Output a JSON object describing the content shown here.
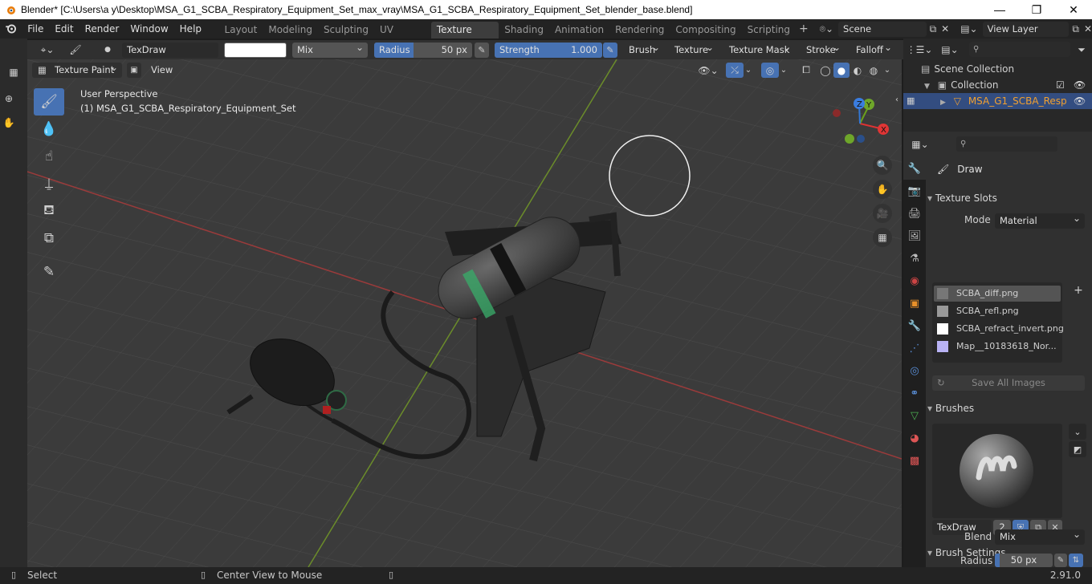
{
  "window": {
    "title": "Blender* [C:\\Users\\a y\\Desktop\\MSA_G1_SCBA_Respiratory_Equipment_Set_max_vray\\MSA_G1_SCBA_Respiratory_Equipment_Set_blender_base.blend]",
    "minimize": "—",
    "maximize": "❐",
    "close": "✕"
  },
  "menu": [
    "File",
    "Edit",
    "Render",
    "Window",
    "Help"
  ],
  "workspaces": [
    "Layout",
    "Modeling",
    "Sculpting",
    "UV Editing",
    "Texture Paint",
    "Shading",
    "Animation",
    "Rendering",
    "Compositing",
    "Scripting"
  ],
  "active_workspace": "Texture Paint",
  "scene": "Scene",
  "view_layer": "View Layer",
  "toolbar": {
    "brush_name": "TexDraw",
    "blend": "Mix",
    "radius_label": "Radius",
    "radius_value": "50 px",
    "strength_label": "Strength",
    "strength_value": "1.000",
    "strength_fraction": 1.0,
    "brush_menu": "Brush",
    "texture_menu": "Texture",
    "texture_mask_menu": "Texture Mask",
    "stroke_menu": "Stroke",
    "falloff_menu": "Falloff"
  },
  "viewport_header": {
    "mode": "Texture Paint",
    "view_menu": "View"
  },
  "viewport": {
    "perspective_label": "User Perspective",
    "object_label": "(1) MSA_G1_SCBA_Respiratory_Equipment_Set",
    "gizmo": {
      "x": "X",
      "y": "Y",
      "z": "Z"
    }
  },
  "outliner": {
    "scene_collection": "Scene Collection",
    "collection": "Collection",
    "object": "MSA_G1_SCBA_Resp"
  },
  "properties": {
    "tool_name": "Draw",
    "texture_slots_header": "Texture Slots",
    "mode_label": "Mode",
    "mode_value": "Material",
    "slots": [
      "SCBA_diff.png",
      "SCBA_refl.png",
      "SCBA_refract_invert.png",
      "Map__10183618_Nor..."
    ],
    "save_all": "Save All Images",
    "brushes_header": "Brushes",
    "brush_name": "TexDraw",
    "brush_users": "2",
    "brush_settings_header": "Brush Settings",
    "blend_label": "Blend",
    "blend_value": "Mix",
    "radius_label": "Radius",
    "radius_value": "50 px"
  },
  "status": {
    "select": "Select",
    "center": "Center View to Mouse",
    "version": "2.91.0"
  }
}
